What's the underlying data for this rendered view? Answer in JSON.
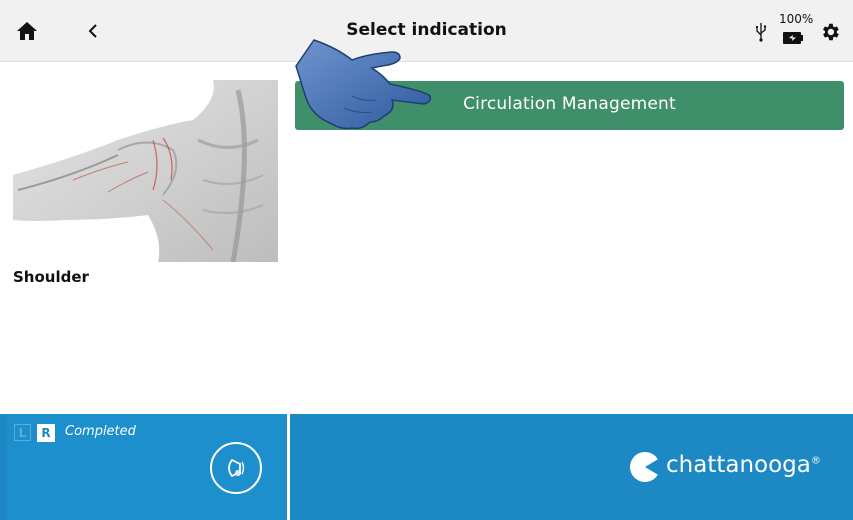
{
  "header": {
    "title": "Select indication",
    "battery_percent": "100%",
    "icons": [
      "home-icon",
      "back-chevron-icon",
      "usb-icon",
      "battery-icon",
      "gear-icon"
    ]
  },
  "content": {
    "body_part": "Shoulder",
    "indications": [
      {
        "label": "Circulation Management"
      }
    ],
    "indication_color": "#3f8f6b"
  },
  "footer": {
    "side_left": "L",
    "side_right": "R",
    "status": "Completed",
    "brand": "chattanooga",
    "brand_mark": "®",
    "color": "#1c88c4"
  }
}
